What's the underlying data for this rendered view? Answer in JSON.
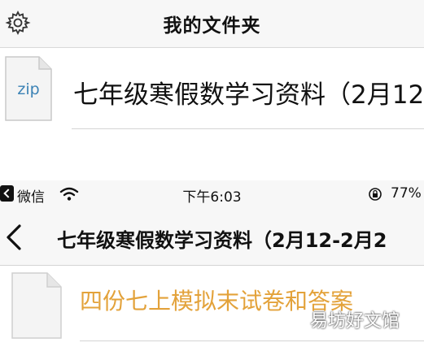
{
  "top": {
    "title": "我的文件夹",
    "file": {
      "type_label": "zip",
      "name": "七年级寒假数学习资料（2月12"
    }
  },
  "status_bar": {
    "app": "微信",
    "time": "下午6:03",
    "battery": "77%"
  },
  "nav": {
    "title": "七年级寒假数学习资料（2月12-2月2"
  },
  "items": [
    {
      "name": "四份七上模拟末试卷和答案"
    }
  ],
  "watermark": "易坊好文馆",
  "colors": {
    "item_name": "#e3a23a",
    "zip_label": "#3b82b5",
    "header_bg": "#f7f7f7"
  },
  "icons": {
    "settings": "gear-icon",
    "file": "zip-file-icon",
    "wifi": "wifi-icon",
    "orientation_lock": "orientation-lock-icon",
    "back": "chevron-left-icon",
    "document": "document-icon"
  }
}
